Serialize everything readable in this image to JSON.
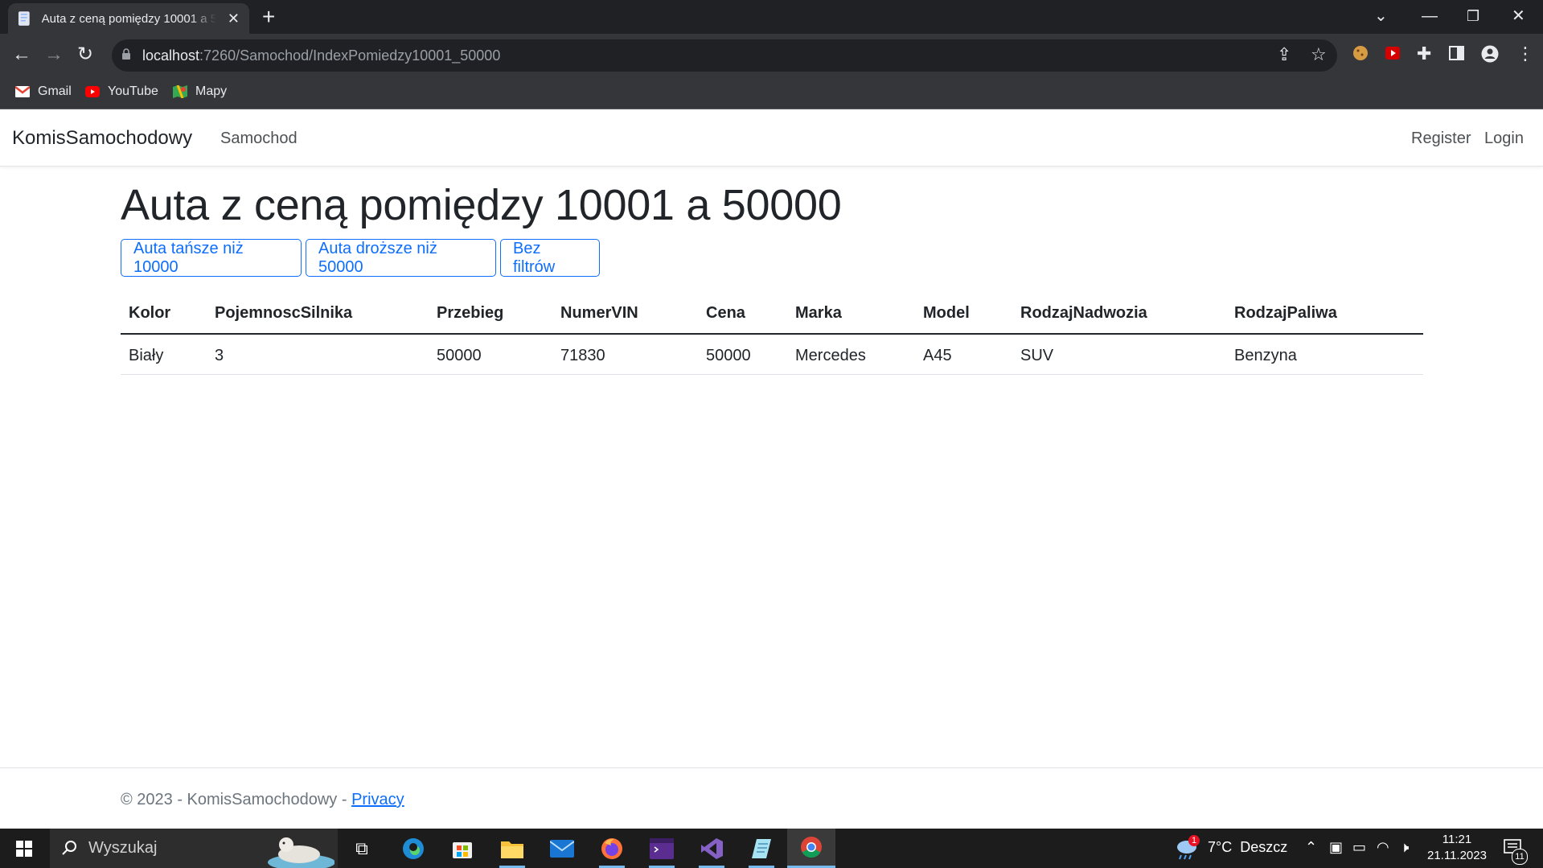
{
  "browser": {
    "tab_title": "Auta z ceną pomiędzy 10001 a 50000",
    "url_host": "localhost",
    "url_path": ":7260/Samochod/IndexPomiedzy10001_50000",
    "bookmarks": [
      "Gmail",
      "YouTube",
      "Mapy"
    ]
  },
  "navbar": {
    "brand": "KomisSamochodowy",
    "link_samochod": "Samochod",
    "register": "Register",
    "login": "Login"
  },
  "main": {
    "title": "Auta z ceną pomiędzy 10001 a 50000",
    "buttons": [
      "Auta tańsze niż 10000",
      "Auta droższe niż 50000",
      "Bez filtrów"
    ],
    "table": {
      "headers": [
        "Kolor",
        "PojemnoscSilnika",
        "Przebieg",
        "NumerVIN",
        "Cena",
        "Marka",
        "Model",
        "RodzajNadwozia",
        "RodzajPaliwa"
      ],
      "rows": [
        [
          "Biały",
          "3",
          "50000",
          "71830",
          "50000",
          "Mercedes",
          "A45",
          "SUV",
          "Benzyna"
        ]
      ]
    }
  },
  "footer": {
    "text": "© 2023 - KomisSamochodowy - ",
    "privacy": "Privacy"
  },
  "taskbar": {
    "search_label": "Wyszukaj",
    "weather": "7°C  Deszcz",
    "weather_badge": "1",
    "time": "11:21",
    "date": "21.11.2023",
    "notifications": "11"
  }
}
